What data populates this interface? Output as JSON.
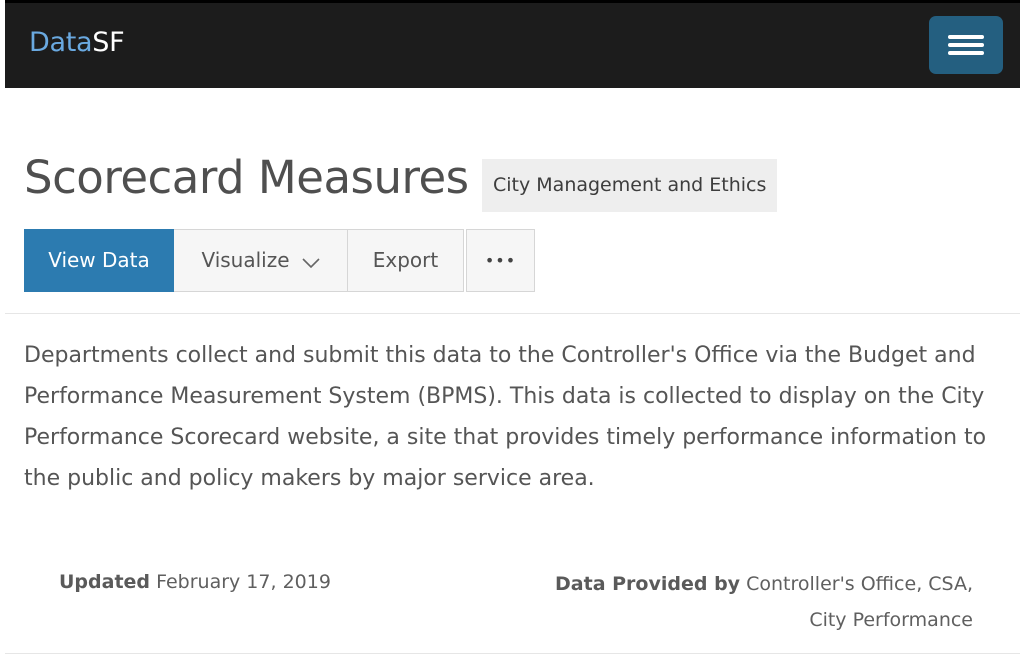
{
  "header": {
    "brand_part1": "Data",
    "brand_part2": "SF",
    "menu_icon": "hamburger-menu-icon",
    "colors": {
      "background": "#1c1c1c",
      "brand_accent": "#6aa9e0",
      "menu_button": "#245f80"
    }
  },
  "dataset": {
    "title": "Scorecard Measures",
    "category": "City Management and Ethics",
    "description": "Departments collect and submit this data to the Controller's Office via the Budget and Performance Measurement System (BPMS). This data is collected to display on the City Performance Scorecard website, a site that provides timely performance information to the public and policy makers by major service area."
  },
  "actions": {
    "view_data": "View Data",
    "visualize": "Visualize",
    "export": "Export",
    "more": "•••",
    "colors": {
      "primary": "#2c7bb0"
    }
  },
  "meta": {
    "updated_label": "Updated",
    "updated_value": "February 17, 2019",
    "provided_label": "Data Provided by",
    "provided_value_line1": "Controller's Office, CSA,",
    "provided_value_line2": "City Performance"
  }
}
